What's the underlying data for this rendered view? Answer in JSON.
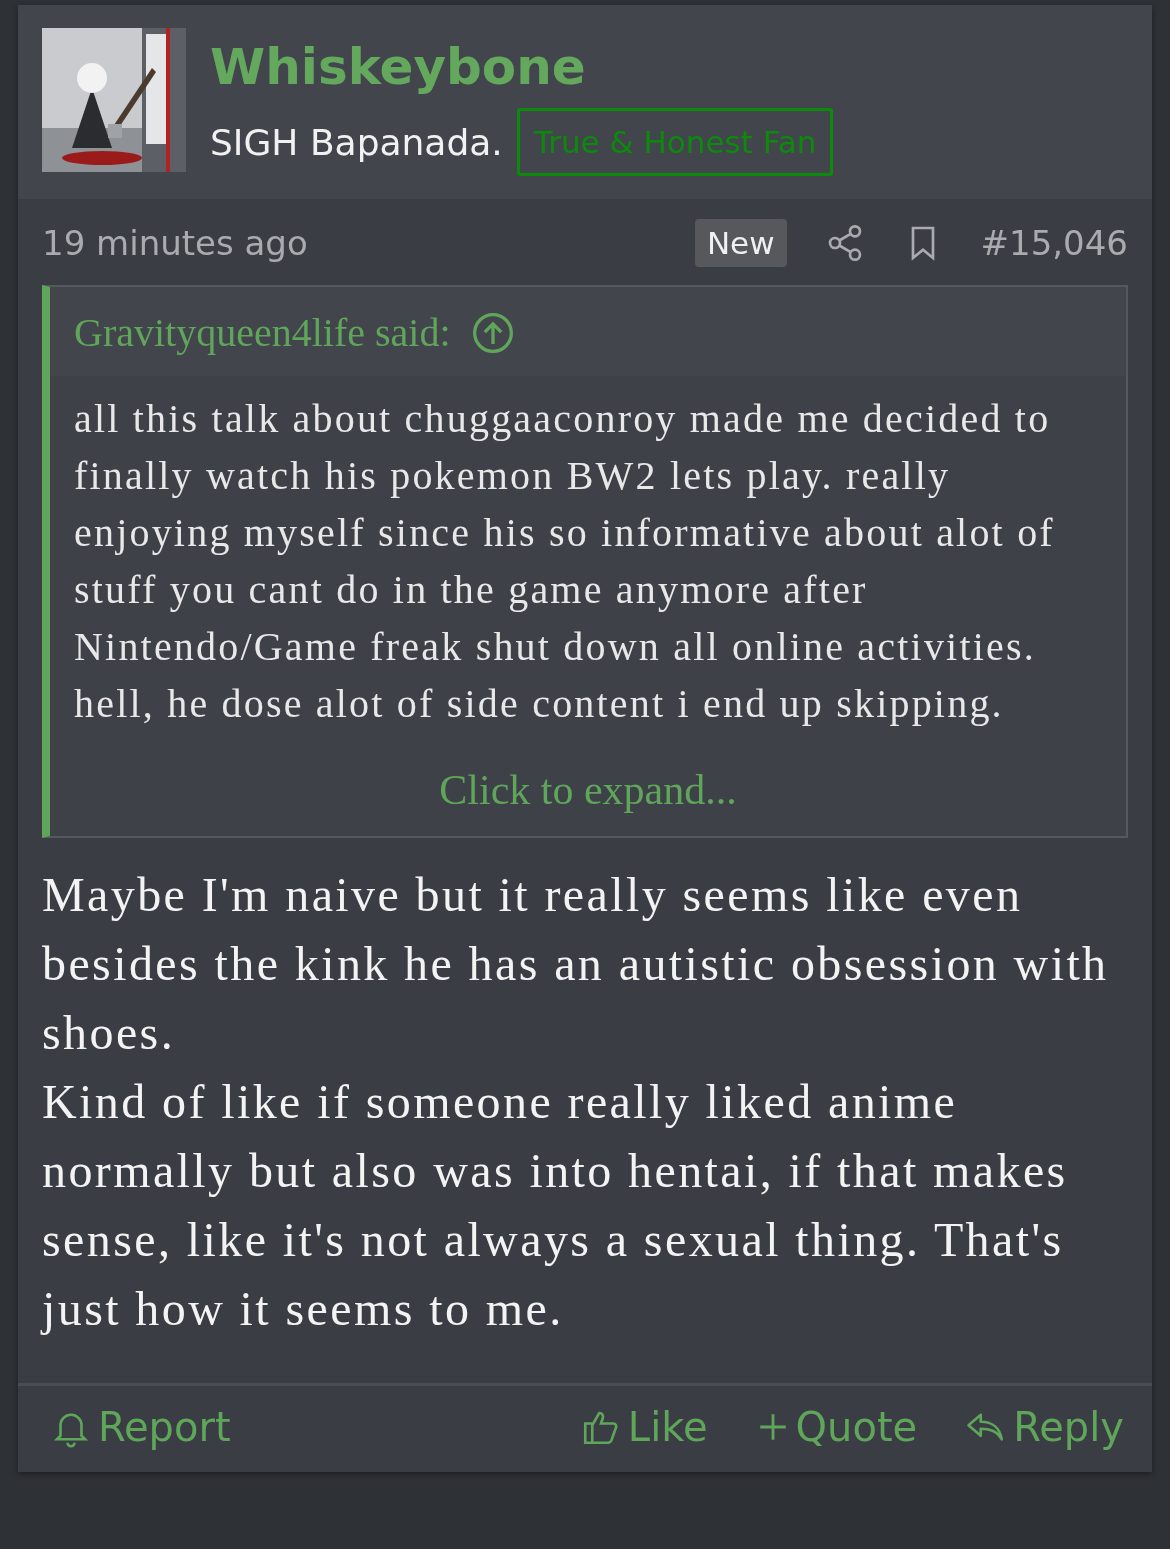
{
  "author": {
    "name": "Whiskeybone",
    "title": "SIGH Bapanada.",
    "banner": "True & Honest Fan"
  },
  "meta": {
    "time": "19 minutes ago",
    "badge": "New",
    "number": "#15,046"
  },
  "quote": {
    "attribution": "Gravityqueen4life said:",
    "text": "all this talk about chuggaaconroy made me decided to finally watch his pokemon BW2 lets play. really enjoying myself since his so informative about alot of stuff you cant do in the game anymore after Nintendo/Game freak shut down all online activities. hell, he dose alot of side content i end up skipping.",
    "expand": "Click to expand..."
  },
  "body": [
    "Maybe I'm naive but it really seems like even besides the kink he has an autistic obsession with shoes.",
    "Kind of like if someone really liked anime normally but also was into hentai, if that makes sense, like it's not always a sexual thing. That's just how it seems to me."
  ],
  "actions": {
    "left": [
      {
        "kind": "report",
        "label": "Report"
      }
    ],
    "right": [
      {
        "kind": "like",
        "label": "Like"
      },
      {
        "kind": "quote",
        "label": "Quote"
      },
      {
        "kind": "reply",
        "label": "Reply"
      }
    ]
  }
}
